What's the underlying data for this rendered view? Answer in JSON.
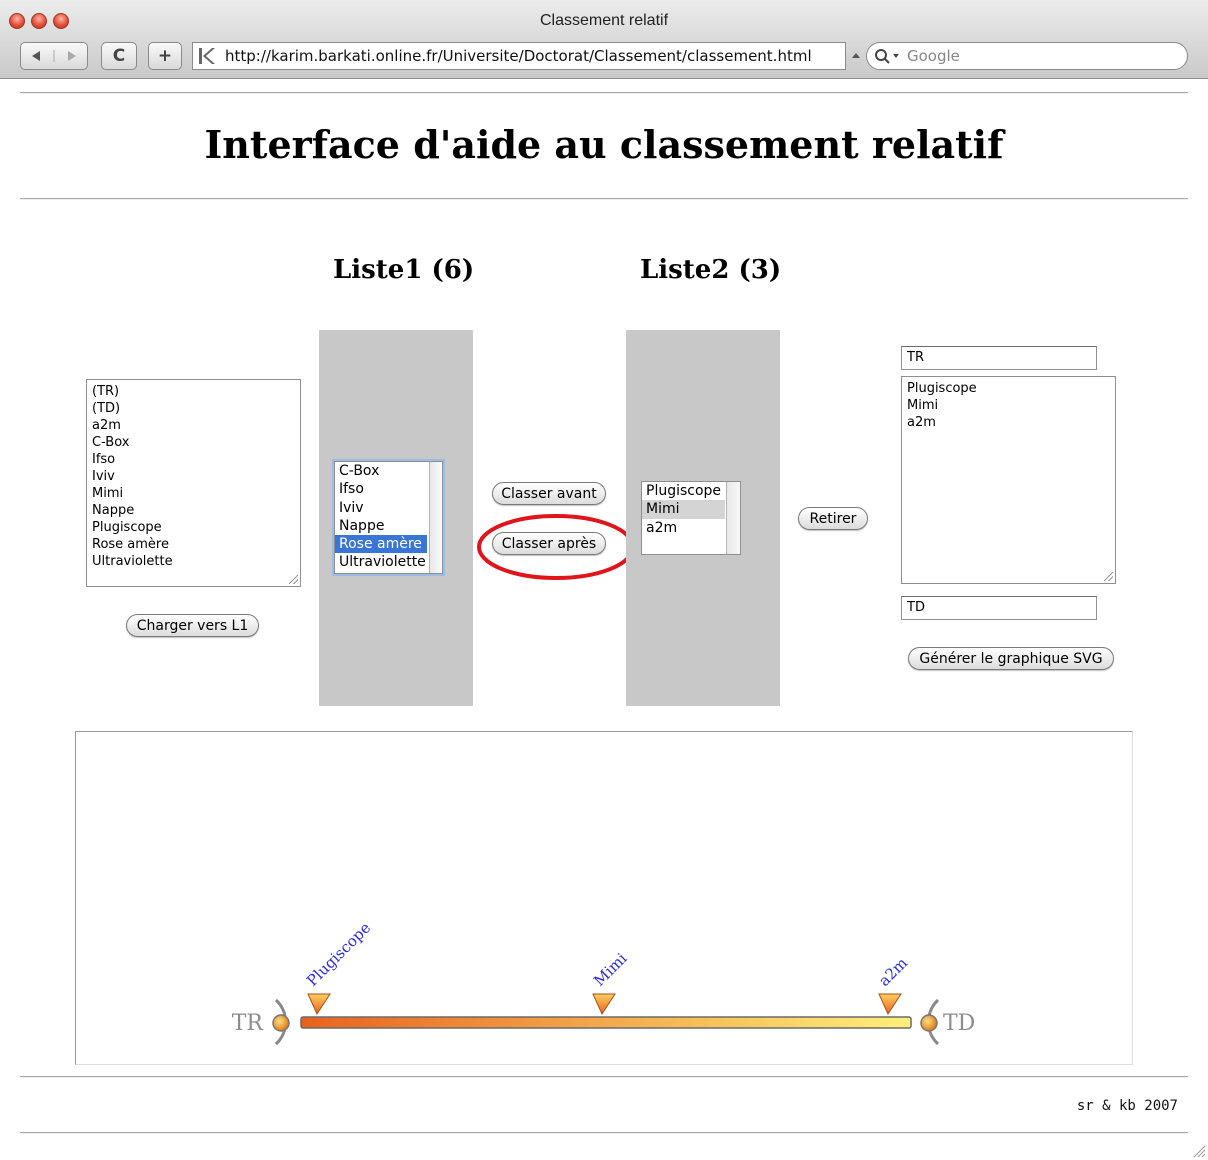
{
  "window": {
    "title": "Classement relatif",
    "url": "http://karim.barkati.online.fr/Universite/Doctorat/Classement/classement.html",
    "search_placeholder": "Google",
    "back_icon": "back-arrow-icon",
    "forward_icon": "forward-arrow-icon",
    "reload_glyph": "C",
    "add_glyph": "+"
  },
  "page": {
    "title": "Interface d'aide au classement relatif",
    "liste1_heading": "Liste1 (6)",
    "liste2_heading": "Liste2 (3)",
    "footer": "sr & kb 2007"
  },
  "source_list": {
    "items": [
      "(TR)",
      "(TD)",
      "a2m",
      "C-Box",
      "Ifso",
      "Iviv",
      "Mimi",
      "Nappe",
      "Plugiscope",
      "Rose amère",
      "Ultraviolette"
    ],
    "load_button": "Charger vers L1"
  },
  "liste1": {
    "items": [
      "C-Box",
      "Ifso",
      "Iviv",
      "Nappe",
      "Rose amère",
      "Ultraviolette"
    ],
    "selected": "Rose amère"
  },
  "actions": {
    "classer_avant": "Classer avant",
    "classer_apres": "Classer après",
    "highlight_color": "#e0141a"
  },
  "liste2": {
    "items": [
      "Plugiscope",
      "Mimi",
      "a2m"
    ],
    "selected_inactive": "Mimi",
    "retirer_button": "Retirer"
  },
  "output": {
    "start_field": "TR",
    "result_items": [
      "Plugiscope",
      "Mimi",
      "a2m"
    ],
    "end_field": "TD",
    "generate_button": "Générer le graphique SVG"
  },
  "graphic": {
    "start_label": "TR",
    "end_label": "TD",
    "markers": [
      "Plugiscope",
      "Mimi",
      "a2m"
    ],
    "gradient_start": "#e8621e",
    "gradient_end": "#fff07a",
    "label_color": "#2a2ae0",
    "end_label_color": "#8c8c8c"
  }
}
